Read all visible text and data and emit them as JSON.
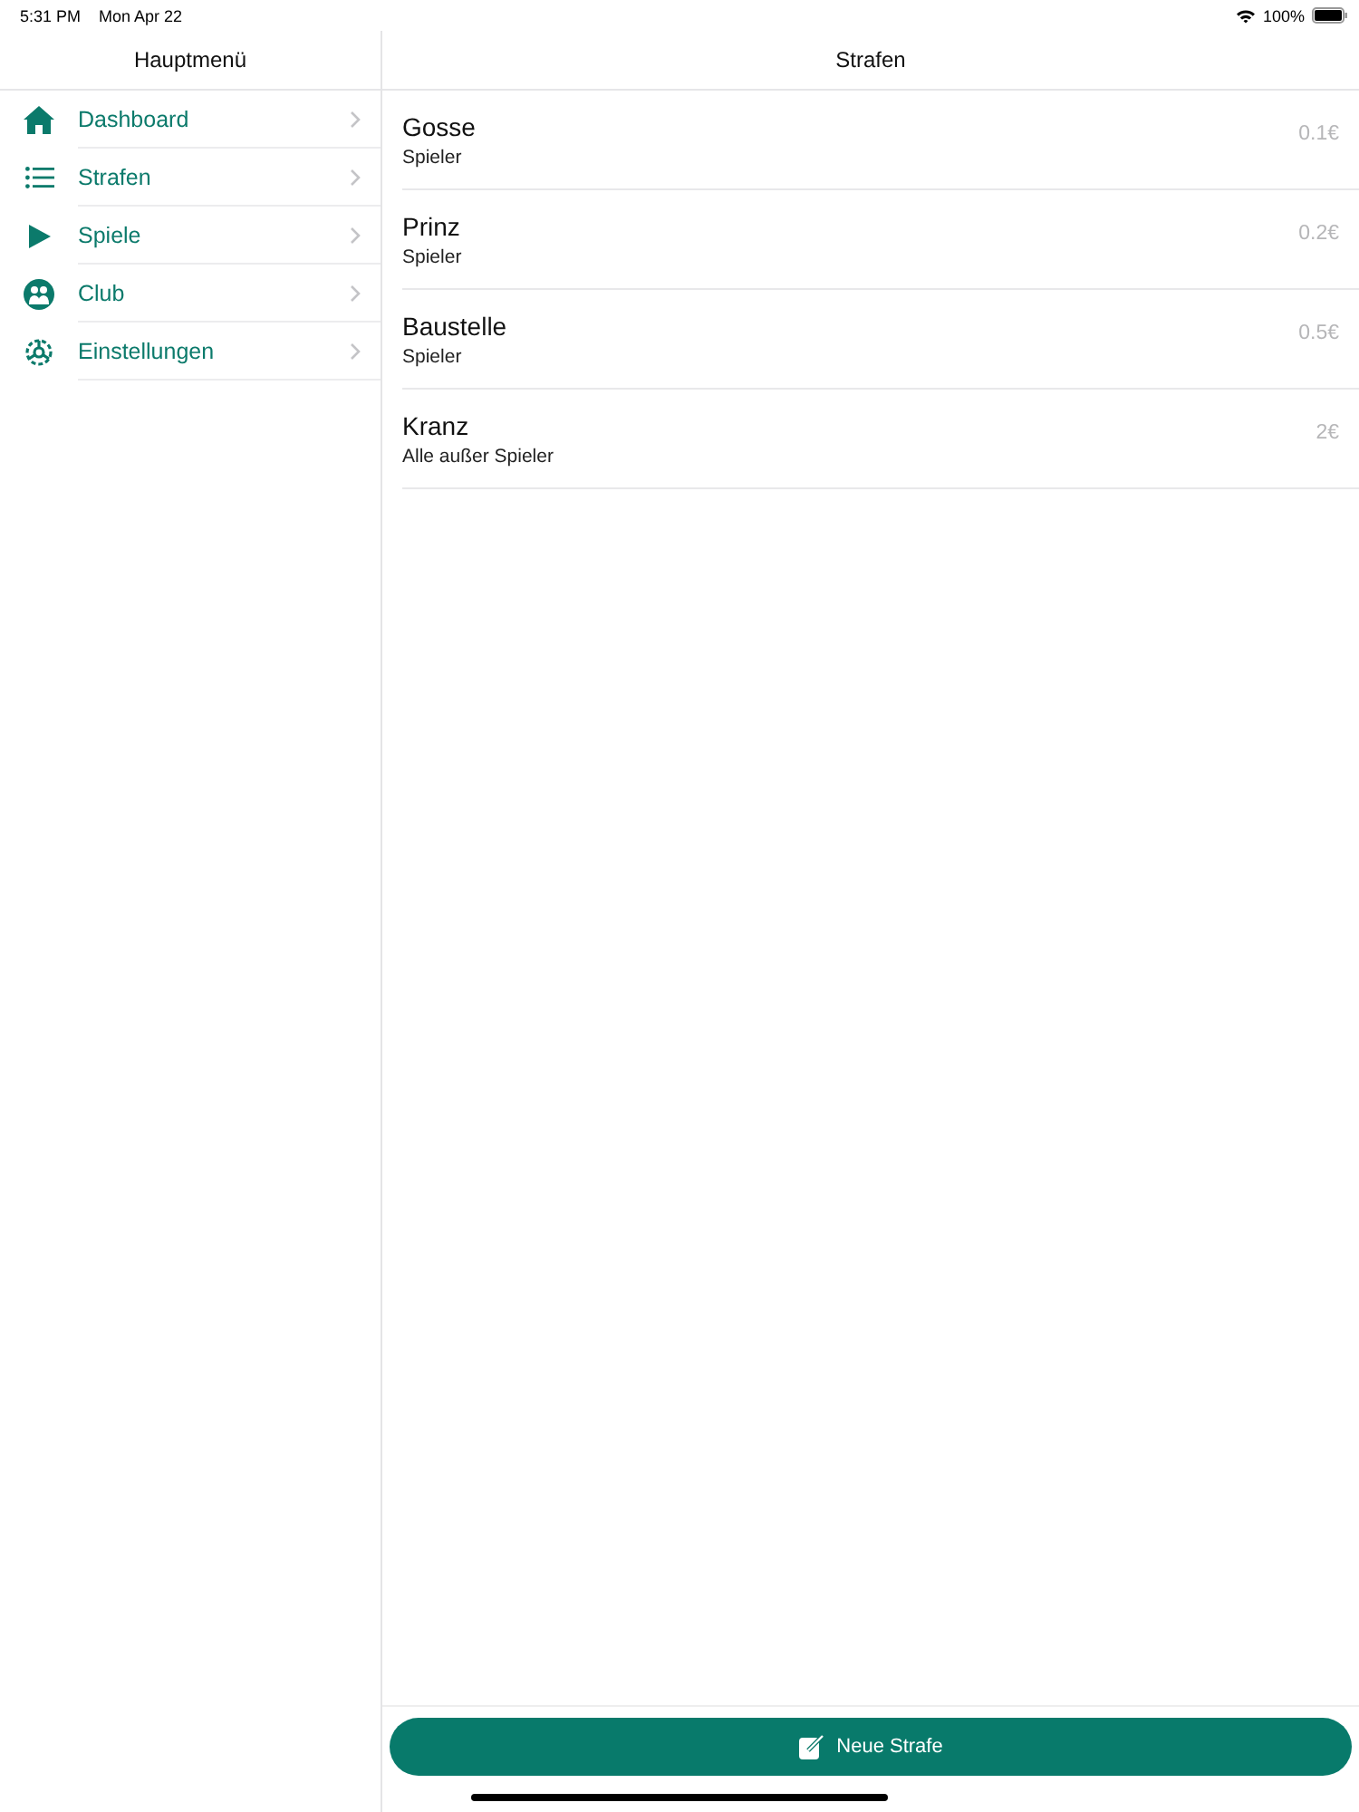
{
  "status_bar": {
    "time": "5:31 PM",
    "date": "Mon Apr 22",
    "battery": "100%"
  },
  "sidebar": {
    "title": "Hauptmenü",
    "items": [
      {
        "label": "Dashboard"
      },
      {
        "label": "Strafen"
      },
      {
        "label": "Spiele"
      },
      {
        "label": "Club"
      },
      {
        "label": "Einstellungen"
      }
    ]
  },
  "main": {
    "title": "Strafen",
    "rows": [
      {
        "name": "Gosse",
        "group": "Spieler",
        "amount": "0.1€"
      },
      {
        "name": "Prinz",
        "group": "Spieler",
        "amount": "0.2€"
      },
      {
        "name": "Baustelle",
        "group": "Spieler",
        "amount": "0.5€"
      },
      {
        "name": "Kranz",
        "group": "Alle außer Spieler",
        "amount": "2€"
      }
    ],
    "button": "Neue Strafe"
  }
}
